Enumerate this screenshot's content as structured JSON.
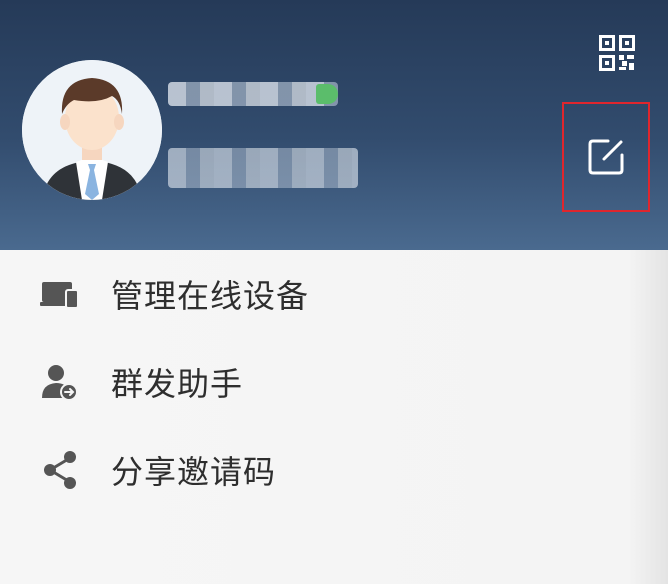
{
  "header": {
    "background_color": "#2c4566",
    "qr_icon": "qr-code-icon",
    "edit_icon": "edit-profile-icon",
    "highlight_color": "#e0262d"
  },
  "menu": {
    "items": [
      {
        "label": "管理在线设备",
        "icon": "devices-icon"
      },
      {
        "label": "群发助手",
        "icon": "broadcast-user-icon"
      },
      {
        "label": "分享邀请码",
        "icon": "share-icon"
      }
    ]
  }
}
